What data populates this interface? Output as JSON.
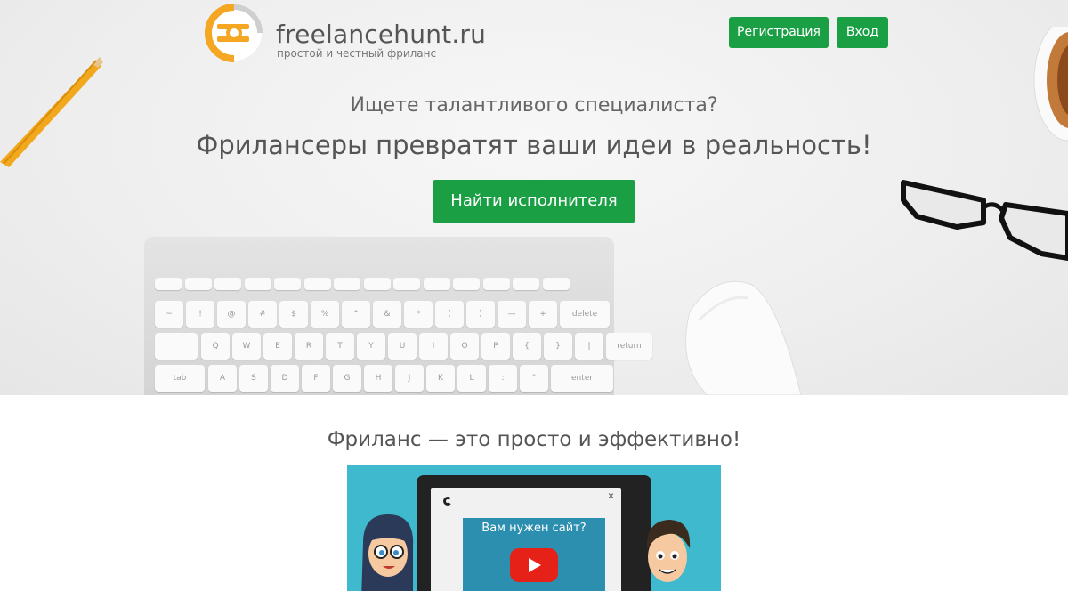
{
  "header": {
    "logo_text": "freelancehunt.ru",
    "logo_tagline": "простой и честный фриланс",
    "register_label": "Регистрация",
    "login_label": "Вход"
  },
  "hero": {
    "question": "Ищете талантливого специалиста?",
    "headline": "Фрилансеры превратят ваши идеи в реальность!",
    "cta_label": "Найти исполнителя"
  },
  "section": {
    "title": "Фриланс — это просто и эффективно!"
  },
  "video": {
    "inner_title": "Вам нужен сайт?",
    "close_glyph": "×"
  },
  "keyboard": {
    "keys_row2": [
      "~",
      "!",
      "@",
      "#",
      "$",
      "%",
      "^",
      "&",
      "*",
      "(",
      ")",
      "—",
      "+"
    ],
    "keys_row3": [
      "Q",
      "W",
      "E",
      "R",
      "T",
      "Y",
      "U",
      "I",
      "O",
      "P",
      "{",
      "}",
      "|"
    ],
    "keys_row4": [
      "A",
      "S",
      "D",
      "F",
      "G",
      "H",
      "J",
      "K",
      "L",
      ":",
      "\""
    ],
    "label_delete": "delete",
    "label_return": "return",
    "label_enter": "enter",
    "label_tab": "tab"
  },
  "colors": {
    "brand_green": "#1a9f45",
    "logo_orange": "#f5a623",
    "video_bg": "#3fb9ce"
  }
}
